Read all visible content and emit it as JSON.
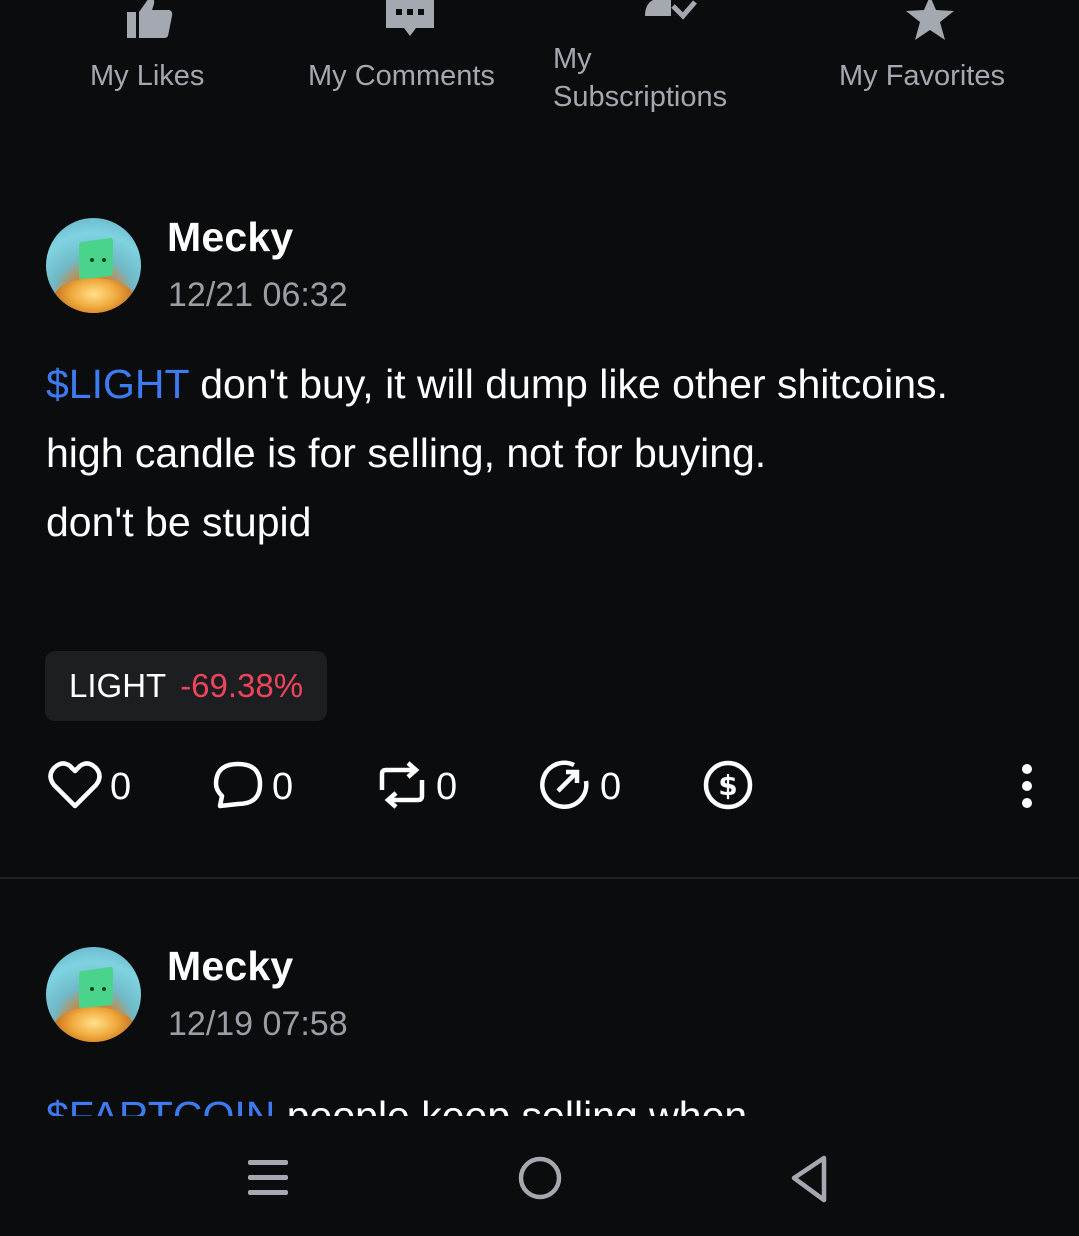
{
  "tabs": [
    {
      "label": "My Likes",
      "icon": "thumbs-up-icon"
    },
    {
      "label": "My Comments",
      "icon": "comment-dots-icon"
    },
    {
      "label": "My Subscriptions",
      "icon": "subscription-icon"
    },
    {
      "label": "My Favorites",
      "icon": "star-icon"
    }
  ],
  "posts": [
    {
      "username": "Mecky",
      "time": "12/21 06:32",
      "ticker": "$LIGHT",
      "text": " don't buy, it will dump like other shitcoins. high candle is for selling, not for buying.",
      "text2": "don't be stupid",
      "chip": {
        "symbol": "LIGHT",
        "change": "-69.38%"
      },
      "likes": "0",
      "comments": "0",
      "reposts": "0",
      "shares": "0"
    },
    {
      "username": "Mecky",
      "time": "12/19 07:58",
      "ticker": "$FARTCOIN",
      "text": " people keep selling when"
    }
  ],
  "colors": {
    "background": "#0b0c0e",
    "ticker": "#3d7bf2",
    "negative": "#f0445a",
    "muted": "#9a9ea6"
  },
  "navbar": {
    "icons": [
      "menu-icon",
      "home-icon",
      "back-icon"
    ]
  }
}
